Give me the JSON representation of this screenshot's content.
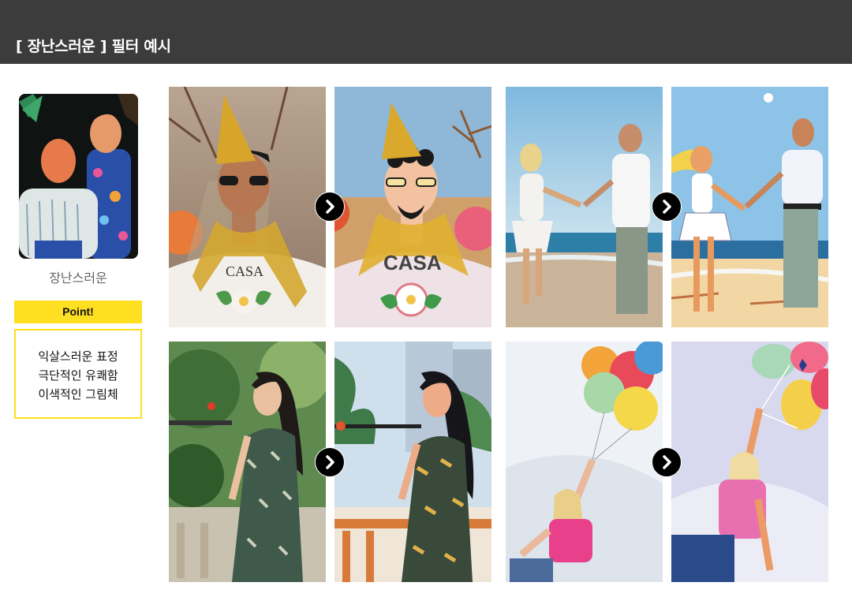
{
  "header": {
    "title": "[ 장난스러운 ] 필터 예시"
  },
  "filter": {
    "name": "장난스러운",
    "point_label": "Point!",
    "points": [
      "익살스러운 표정",
      "극단적인 유쾌함",
      "이색적인 그림체"
    ]
  },
  "icons": {
    "next": "chevron-right-icon"
  },
  "colors": {
    "header_bg": "#3c3c3c",
    "accent": "#ffdf22"
  },
  "examples": [
    {
      "id": "party-man",
      "original": {
        "shirt_text": "CASA"
      },
      "filtered": {
        "shirt_text": "CASA"
      }
    },
    {
      "id": "beach-couple"
    },
    {
      "id": "woman-dress"
    },
    {
      "id": "girl-balloons"
    }
  ]
}
